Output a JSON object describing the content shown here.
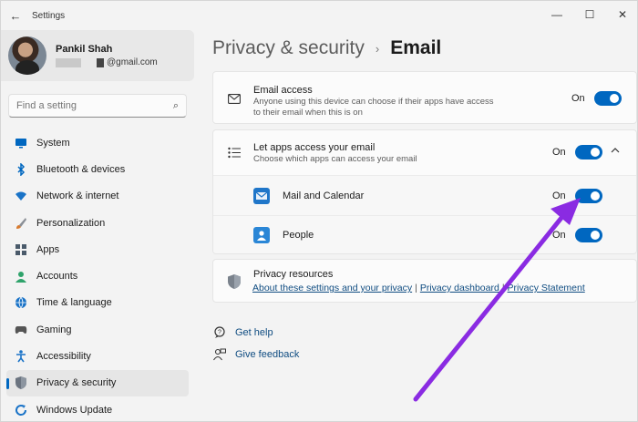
{
  "window": {
    "title": "Settings",
    "controls": [
      "—",
      "☐",
      "✕"
    ]
  },
  "profile": {
    "name": "Pankil Shah",
    "email_suffix": "@gmail.com"
  },
  "search": {
    "placeholder": "Find a setting"
  },
  "nav": [
    {
      "label": "System",
      "icon": "monitor-icon",
      "color": "#0067c0"
    },
    {
      "label": "Bluetooth & devices",
      "icon": "bluetooth-icon",
      "color": "#0067c0"
    },
    {
      "label": "Network & internet",
      "icon": "wifi-icon",
      "color": "#1a73c7"
    },
    {
      "label": "Personalization",
      "icon": "brush-icon",
      "color": "#d87a2e"
    },
    {
      "label": "Apps",
      "icon": "apps-icon",
      "color": "#4a5a6a"
    },
    {
      "label": "Accounts",
      "icon": "person-icon",
      "color": "#2fa36b"
    },
    {
      "label": "Time & language",
      "icon": "globe-icon",
      "color": "#1a73c7"
    },
    {
      "label": "Gaming",
      "icon": "gamepad-icon",
      "color": "#555555"
    },
    {
      "label": "Accessibility",
      "icon": "accessibility-icon",
      "color": "#1a73c7"
    },
    {
      "label": "Privacy & security",
      "icon": "shield-icon",
      "color": "#6b7480",
      "active": true
    },
    {
      "label": "Windows Update",
      "icon": "update-icon",
      "color": "#1a73c7"
    }
  ],
  "breadcrumb": {
    "parent": "Privacy & security",
    "separator": "›",
    "current": "Email"
  },
  "email_access": {
    "title": "Email access",
    "description": "Anyone using this device can choose if their apps have access to their email when this is on",
    "state": "On"
  },
  "let_apps": {
    "title": "Let apps access your email",
    "description": "Choose which apps can access your email",
    "state": "On",
    "apps": [
      {
        "label": "Mail and Calendar",
        "state": "On",
        "icon": "mail-calendar-icon"
      },
      {
        "label": "People",
        "state": "On",
        "icon": "people-icon"
      }
    ]
  },
  "privacy_resources": {
    "title": "Privacy resources",
    "links": [
      "About these settings and your privacy",
      "Privacy dashboard",
      "Privacy Statement"
    ]
  },
  "help": {
    "get_help": "Get help",
    "give_feedback": "Give feedback"
  },
  "colors": {
    "accent": "#0067c0",
    "annotation_arrow": "#8a2be2"
  }
}
